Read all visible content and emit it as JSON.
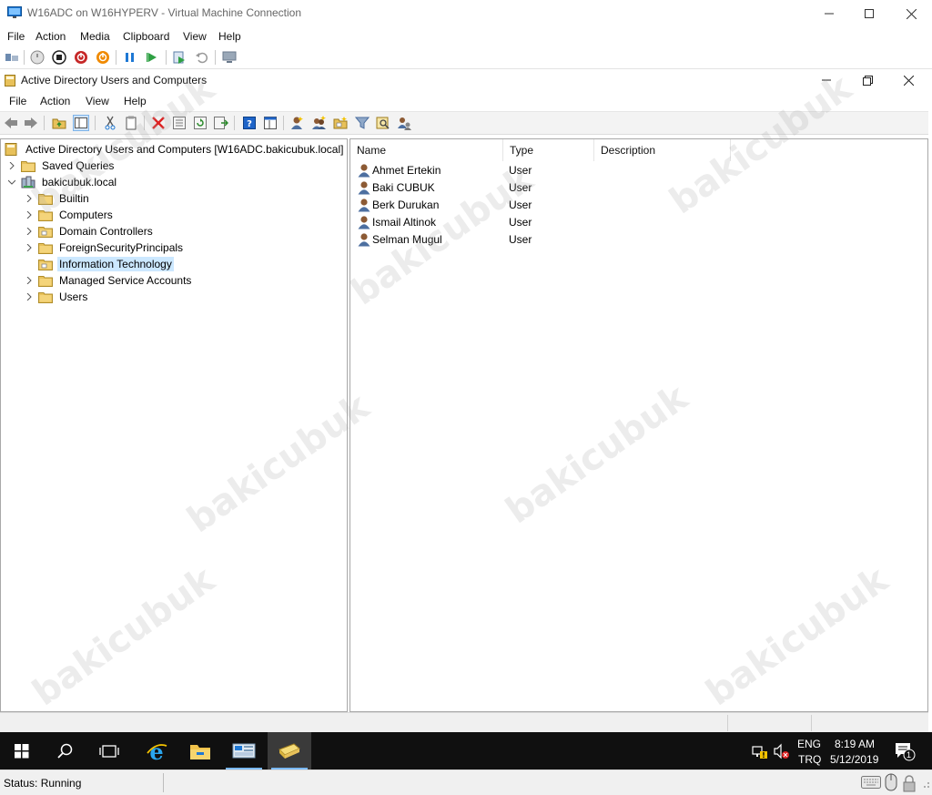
{
  "vm_window": {
    "title": "W16ADC on W16HYPERV - Virtual Machine Connection",
    "menu": [
      "File",
      "Action",
      "Media",
      "Clipboard",
      "View",
      "Help"
    ],
    "toolbar_icons": [
      "ctrl-alt-del-icon",
      "start-icon",
      "turn-off-icon",
      "shut-down-icon",
      "save-state-icon",
      "pause-icon",
      "resume-icon",
      "checkpoint-icon",
      "revert-icon",
      "enhanced-session-icon"
    ],
    "status": "Status: Running"
  },
  "mmc": {
    "title": "Active Directory Users and Computers",
    "menu": [
      "File",
      "Action",
      "View",
      "Help"
    ],
    "toolbar_icons": [
      "back-icon",
      "forward-icon",
      "up-folder-icon",
      "show-hide-tree-icon",
      "cut-icon",
      "copy-icon",
      "delete-icon",
      "properties-icon",
      "refresh-icon",
      "export-list-icon",
      "help-icon",
      "view-icon",
      "new-user-icon",
      "new-group-icon",
      "new-ou-icon",
      "filter-icon",
      "find-icon",
      "delegate-icon"
    ]
  },
  "tree": {
    "root": "Active Directory Users and Computers [W16ADC.bakicubuk.local]",
    "saved_queries": "Saved Queries",
    "domain": "bakicubuk.local",
    "children": [
      "Builtin",
      "Computers",
      "Domain Controllers",
      "ForeignSecurityPrincipals",
      "Information Technology",
      "Managed Service Accounts",
      "Users"
    ],
    "selected": "Information Technology"
  },
  "list": {
    "columns": [
      "Name",
      "Type",
      "Description"
    ],
    "rows": [
      {
        "name": "Ahmet Ertekin",
        "type": "User"
      },
      {
        "name": "Baki CUBUK",
        "type": "User"
      },
      {
        "name": "Berk Durukan",
        "type": "User"
      },
      {
        "name": "Ismail Altinok",
        "type": "User"
      },
      {
        "name": "Selman Mugul",
        "type": "User"
      }
    ]
  },
  "taskbar": {
    "apps": [
      "start-icon",
      "search-icon",
      "task-view-icon",
      "internet-explorer-icon",
      "file-explorer-icon",
      "server-manager-icon",
      "active-directory-icon"
    ],
    "lang_top": "ENG",
    "lang_bottom": "TRQ",
    "time": "8:19 AM",
    "date": "5/12/2019",
    "notification_count": "1"
  },
  "watermark": "bakicubuk",
  "colors": {
    "selection": "#cce8ff",
    "taskbar": "#101010",
    "folder": "#e8c15a",
    "accent_blue": "#1e78d4"
  }
}
